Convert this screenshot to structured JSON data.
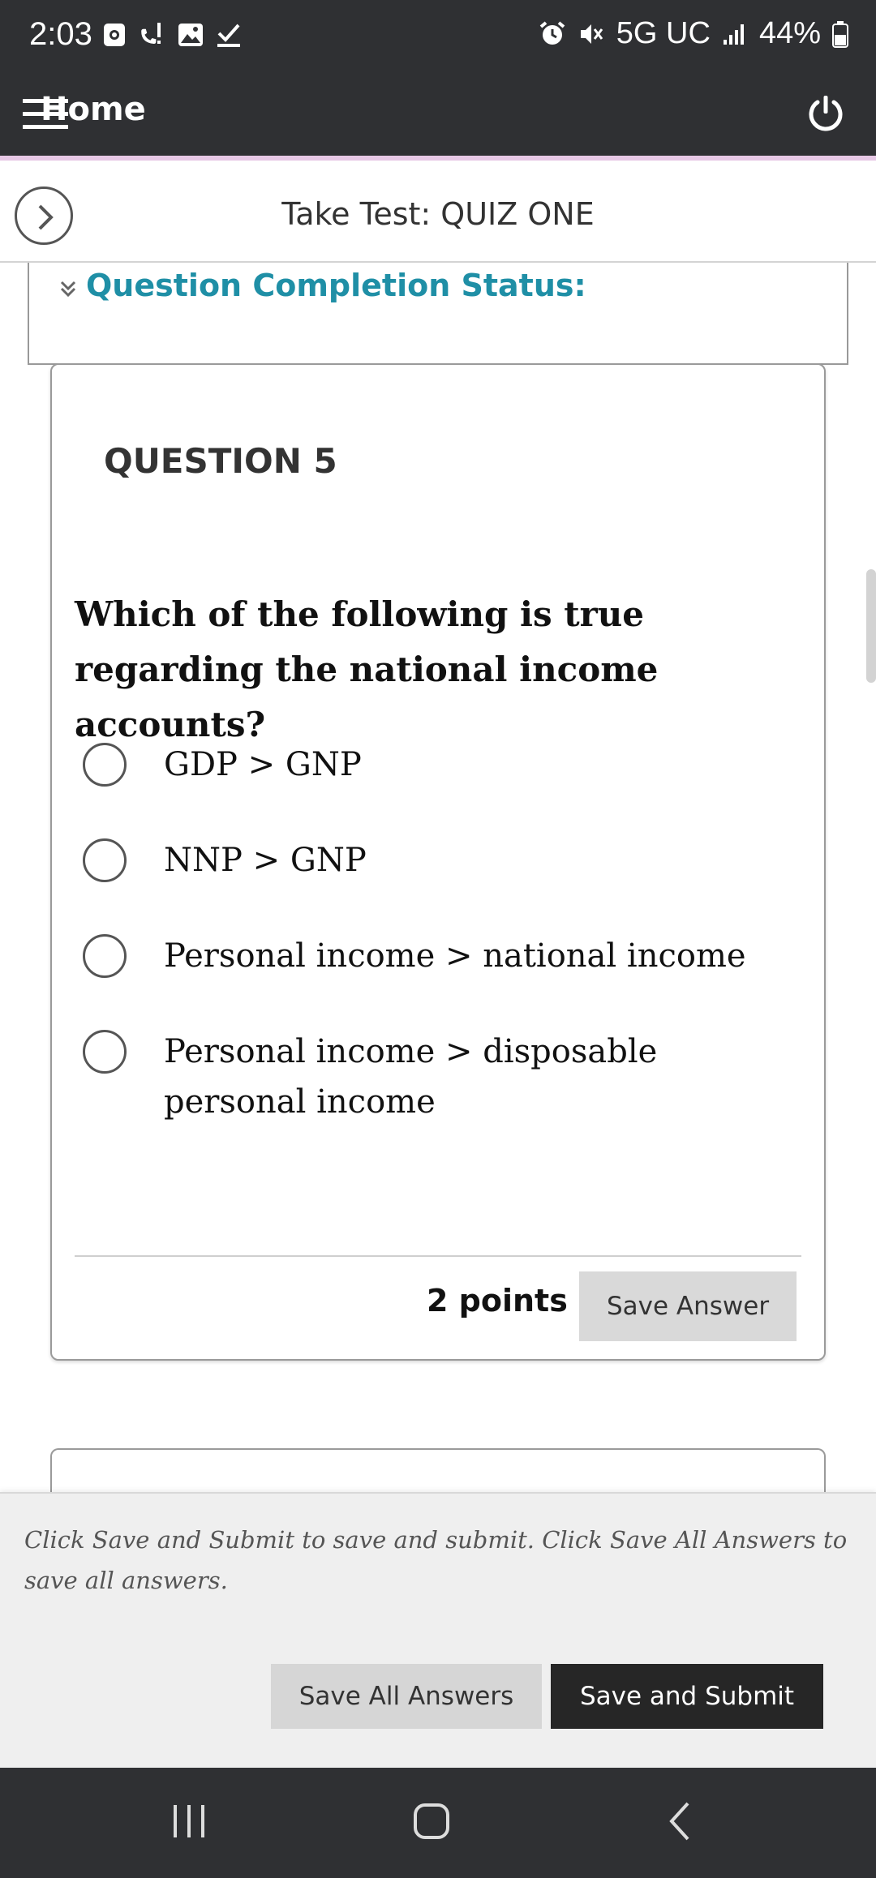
{
  "status_bar": {
    "time": "2:03",
    "network": "5G UC",
    "battery": "44%",
    "left_icons": [
      "screen-record-icon",
      "call-alert-icon",
      "gallery-icon",
      "checkmark-icon"
    ],
    "right_icons": [
      "alarm-icon",
      "mute-icon",
      "signal-icon",
      "battery-icon"
    ]
  },
  "app_header": {
    "title": "Home",
    "icons": [
      "menu-icon",
      "power-icon"
    ]
  },
  "test_header": {
    "title": "Take Test: QUIZ ONE"
  },
  "completion_status": {
    "label": "Question Completion Status:"
  },
  "question": {
    "number_label": "QUESTION 5",
    "text": "Which of the following is true regarding the national income accounts?",
    "options": [
      {
        "label": "GDP > GNP",
        "selected": false
      },
      {
        "label": "NNP > GNP",
        "selected": false
      },
      {
        "label": "Personal income > national income",
        "selected": false
      },
      {
        "label": "Personal income > disposable personal income",
        "selected": false
      }
    ],
    "points": "2 points",
    "save_label": "Save Answer"
  },
  "submit_panel": {
    "note": "Click Save and Submit to save and submit. Click Save All Answers to save all answers.",
    "save_all_label": "Save All Answers",
    "submit_label": "Save and Submit"
  },
  "colors": {
    "bar_bg": "#2f3033",
    "accent_teal": "#1f8fa6",
    "header_underline": "#e7c8e6",
    "submit_bg": "#262626"
  }
}
